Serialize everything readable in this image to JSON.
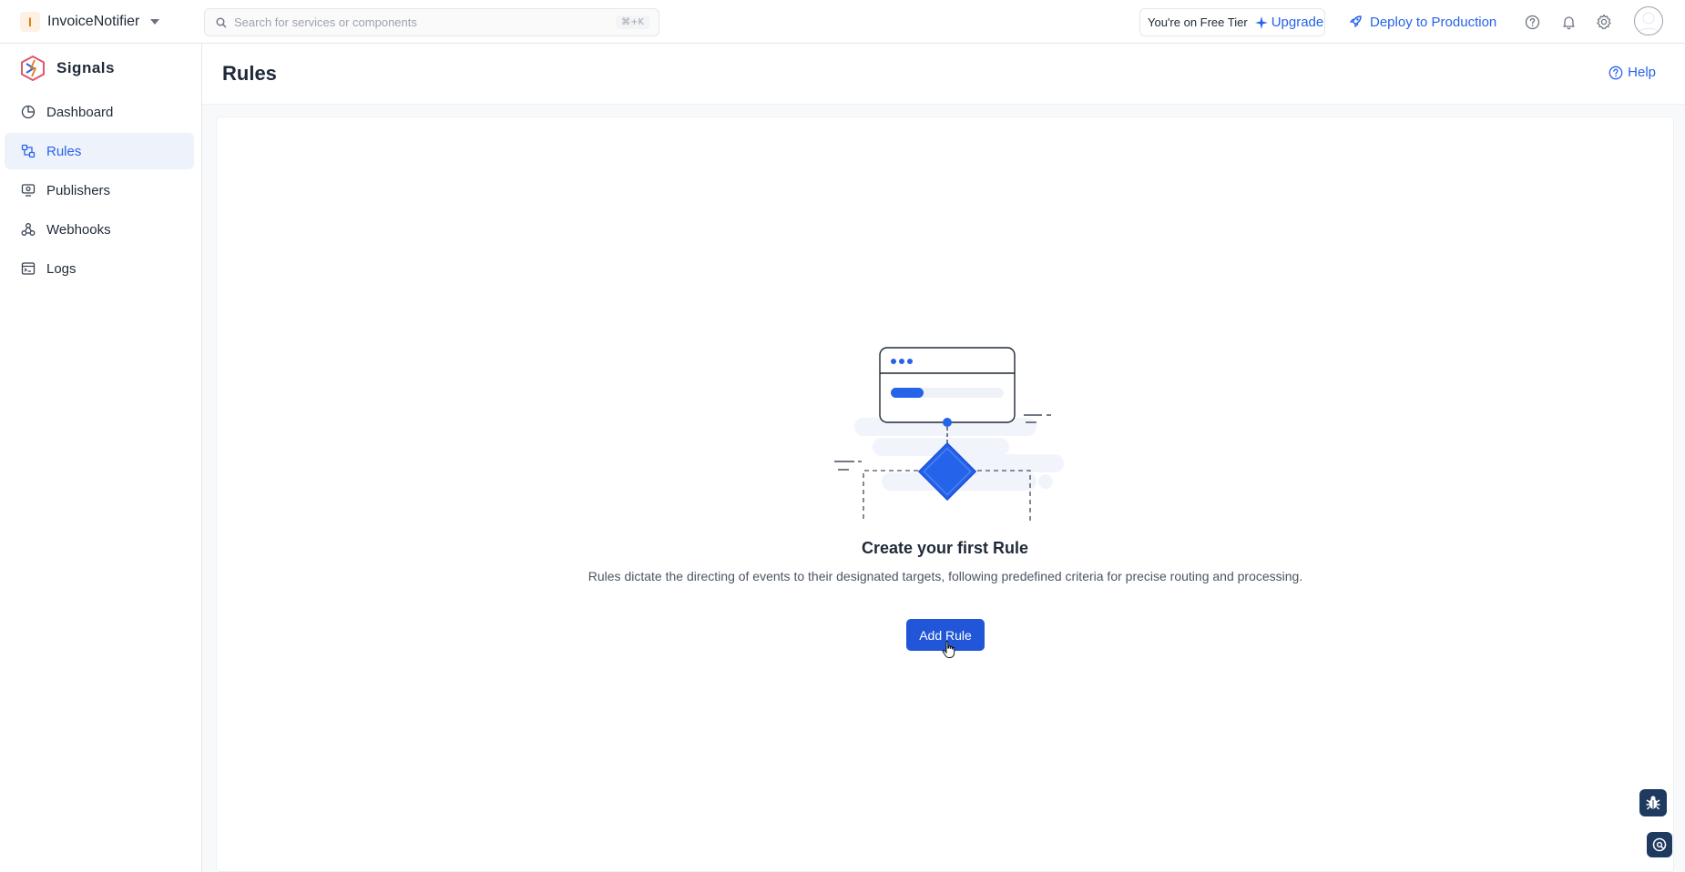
{
  "topbar": {
    "app_badge": "I",
    "app_name": "InvoiceNotifier",
    "search_placeholder": "Search for services or components",
    "search_shortcut": "⌘+K",
    "tier_text": "You're on Free Tier",
    "upgrade_label": "Upgrade",
    "deploy_label": "Deploy to Production",
    "icons": [
      "question-icon",
      "bell-icon",
      "gear-icon",
      "avatar"
    ]
  },
  "sidebar": {
    "brand": "Signals",
    "items": [
      {
        "label": "Dashboard",
        "icon": "pie-chart-icon",
        "active": false
      },
      {
        "label": "Rules",
        "icon": "rules-icon",
        "active": true
      },
      {
        "label": "Publishers",
        "icon": "publisher-icon",
        "active": false
      },
      {
        "label": "Webhooks",
        "icon": "webhook-icon",
        "active": false
      },
      {
        "label": "Logs",
        "icon": "logs-icon",
        "active": false
      }
    ]
  },
  "page": {
    "title": "Rules",
    "help_label": "Help"
  },
  "empty_state": {
    "title": "Create your first Rule",
    "description": "Rules dictate the directing of events to their designated targets, following predefined criteria for precise routing and processing.",
    "button_label": "Add Rule"
  },
  "colors": {
    "accent": "#2563eb",
    "button": "#2156d8",
    "active_nav_bg": "#eef2fb"
  }
}
